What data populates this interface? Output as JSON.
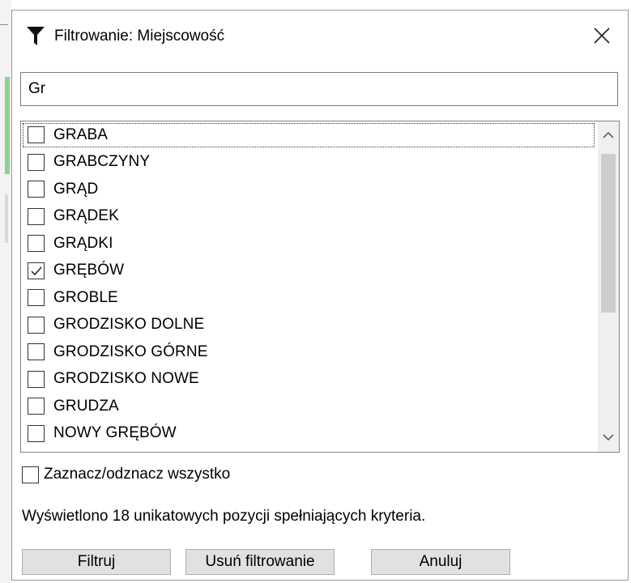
{
  "dialog": {
    "title": "Filtrowanie: Miejscowość",
    "title_icon": "filter-icon",
    "close_icon": "close-icon"
  },
  "search": {
    "value": "Gr"
  },
  "list": {
    "items": [
      {
        "label": "GRABA",
        "checked": false
      },
      {
        "label": "GRABCZYNY",
        "checked": false
      },
      {
        "label": "GRĄD",
        "checked": false
      },
      {
        "label": "GRĄDEK",
        "checked": false
      },
      {
        "label": "GRĄDKI",
        "checked": false
      },
      {
        "label": "GRĘBÓW",
        "checked": true
      },
      {
        "label": "GROBLE",
        "checked": false
      },
      {
        "label": "GRODZISKO DOLNE",
        "checked": false
      },
      {
        "label": "GRODZISKO GÓRNE",
        "checked": false
      },
      {
        "label": "GRODZISKO NOWE",
        "checked": false
      },
      {
        "label": "GRUDZA",
        "checked": false
      },
      {
        "label": "NOWY GRĘBÓW",
        "checked": false
      }
    ]
  },
  "select_all": {
    "label": "Zaznacz/odznacz wszystko",
    "checked": false
  },
  "status": "Wyświetlono 18 unikatowych pozycji spełniających kryteria.",
  "buttons": {
    "filter": "Filtruj",
    "clear": "Usuń filtrowanie",
    "cancel": "Anuluj"
  }
}
